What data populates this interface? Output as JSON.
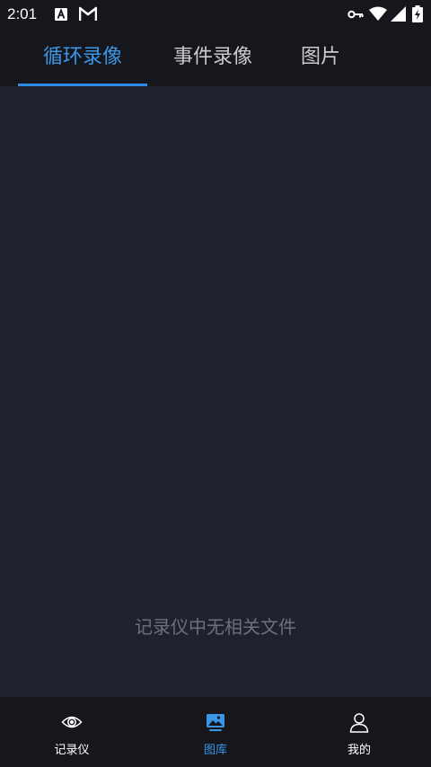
{
  "status_bar": {
    "time": "2:01",
    "icons": [
      "a-badge-icon",
      "gmail-m-icon",
      "vpn-key-icon",
      "wifi-icon",
      "cell-signal-icon",
      "battery-charging-icon"
    ]
  },
  "tabs": [
    {
      "label": "循环录像",
      "active": true
    },
    {
      "label": "事件录像",
      "active": false
    },
    {
      "label": "图片",
      "active": false
    }
  ],
  "main": {
    "empty_message": "记录仪中无相关文件"
  },
  "bottom_nav": {
    "items": [
      {
        "label": "记录仪",
        "icon": "eye-icon",
        "active": false
      },
      {
        "label": "图库",
        "icon": "gallery-icon",
        "active": true
      },
      {
        "label": "我的",
        "icon": "person-icon",
        "active": false
      }
    ]
  },
  "colors": {
    "accent": "#3c96e8",
    "bar_background": "#15171c",
    "content_background": "#1f222d",
    "muted_text": "#6c707b",
    "tab_inactive": "#c9cbd1"
  }
}
